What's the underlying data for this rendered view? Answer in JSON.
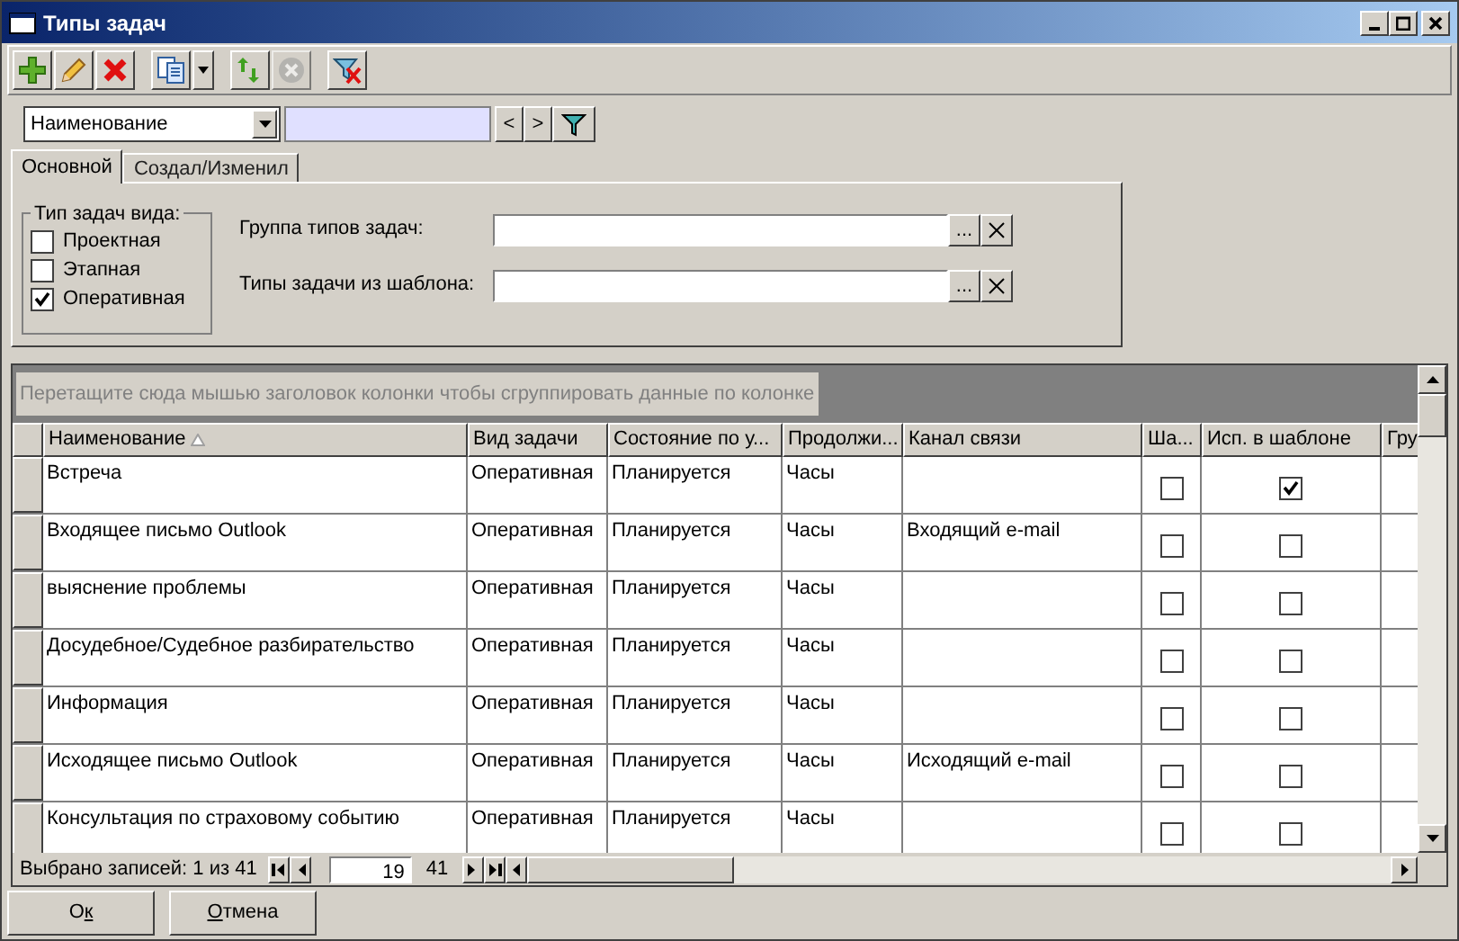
{
  "window": {
    "title": "Типы задач"
  },
  "toolbar": [
    {
      "kind": "add",
      "disabled": false
    },
    {
      "kind": "edit",
      "disabled": false
    },
    {
      "kind": "delete",
      "disabled": false
    },
    {
      "kind": "copy",
      "disabled": false
    },
    {
      "kind": "refresh",
      "disabled": false
    },
    {
      "kind": "cancel",
      "disabled": true
    },
    {
      "kind": "clear_filter",
      "disabled": false
    }
  ],
  "filter": {
    "field": "Наименование",
    "prev": "<",
    "next": ">"
  },
  "tabs": [
    {
      "label": "Основной",
      "selected": true
    },
    {
      "label": "Создал/Изменил",
      "selected": false
    }
  ],
  "type_group": {
    "title": "Тип задач вида:",
    "options": [
      {
        "label": "Проектная",
        "checked": false
      },
      {
        "label": "Этапная",
        "checked": false
      },
      {
        "label": "Оперативная",
        "checked": true
      }
    ]
  },
  "fields": [
    {
      "label": "Группа типов задач:",
      "browse": "..."
    },
    {
      "label": "Типы задачи из шаблона:",
      "browse": "..."
    }
  ],
  "grid": {
    "group_hint": "Перетащите сюда мышью заголовок колонки чтобы сгруппировать данные по колонке",
    "columns": [
      {
        "label": "Наименование",
        "kind": "text",
        "sorted": true
      },
      {
        "label": "Вид задачи",
        "kind": "text",
        "sorted": false
      },
      {
        "label": "Состояние по у...",
        "kind": "text",
        "sorted": false
      },
      {
        "label": "Продолжи...",
        "kind": "text",
        "sorted": false
      },
      {
        "label": "Канал связи",
        "kind": "text",
        "sorted": false
      },
      {
        "label": "Ша...",
        "kind": "check",
        "sorted": false
      },
      {
        "label": "Исп. в шаблоне",
        "kind": "check",
        "sorted": false
      },
      {
        "label": "Гру",
        "kind": "text",
        "sorted": false
      }
    ],
    "rows": [
      {
        "cells": [
          "Встреча",
          "Оперативная",
          "Планируется",
          "Часы",
          null,
          {
            "checked": false
          },
          {
            "checked": true
          },
          null
        ]
      },
      {
        "cells": [
          "Входящее письмо Outlook",
          "Оперативная",
          "Планируется",
          "Часы",
          "Входящий e-mail",
          {
            "checked": false
          },
          {
            "checked": false
          },
          null
        ]
      },
      {
        "cells": [
          "выяснение проблемы",
          "Оперативная",
          "Планируется",
          "Часы",
          null,
          {
            "checked": false
          },
          {
            "checked": false
          },
          null
        ]
      },
      {
        "cells": [
          "Досудебное/Судебное разбирательство",
          "Оперативная",
          "Планируется",
          "Часы",
          null,
          {
            "checked": false
          },
          {
            "checked": false
          },
          null
        ]
      },
      {
        "cells": [
          "Информация",
          "Оперативная",
          "Планируется",
          "Часы",
          null,
          {
            "checked": false
          },
          {
            "checked": false
          },
          null
        ]
      },
      {
        "cells": [
          "Исходящее письмо Outlook",
          "Оперативная",
          "Планируется",
          "Часы",
          "Исходящий e-mail",
          {
            "checked": false
          },
          {
            "checked": false
          },
          null
        ]
      },
      {
        "cells": [
          "Консультация по страховому событию",
          "Оперативная",
          "Планируется",
          "Часы",
          null,
          {
            "checked": false
          },
          {
            "checked": false
          },
          null
        ]
      }
    ],
    "status": "Выбрано записей: 1 из 41",
    "current": "19",
    "total": "41"
  },
  "buttons": [
    {
      "parts": [
        {
          "text": "О",
          "underlined": false
        },
        {
          "text": "к",
          "underlined": true
        }
      ]
    },
    {
      "parts": [
        {
          "text": "О",
          "underlined": true
        },
        {
          "text": "тмена",
          "underlined": false
        }
      ]
    }
  ]
}
